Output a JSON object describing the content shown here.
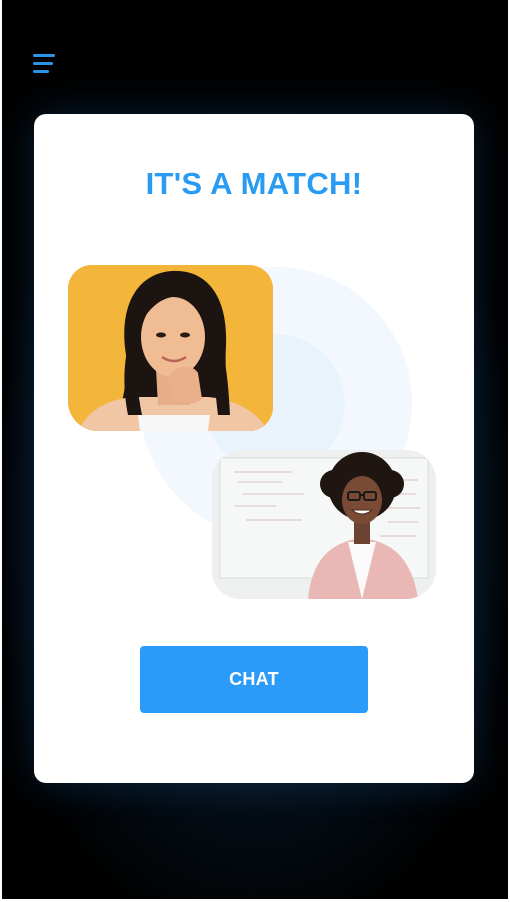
{
  "header": {
    "menu_icon": "hamburger-menu-icon"
  },
  "match": {
    "title": "IT'S A MATCH!",
    "chat_label": "CHAT"
  },
  "colors": {
    "accent": "#2a9bf2",
    "button": "#2a9bf8",
    "card_bg": "#ffffff",
    "page_bg": "#000000"
  }
}
